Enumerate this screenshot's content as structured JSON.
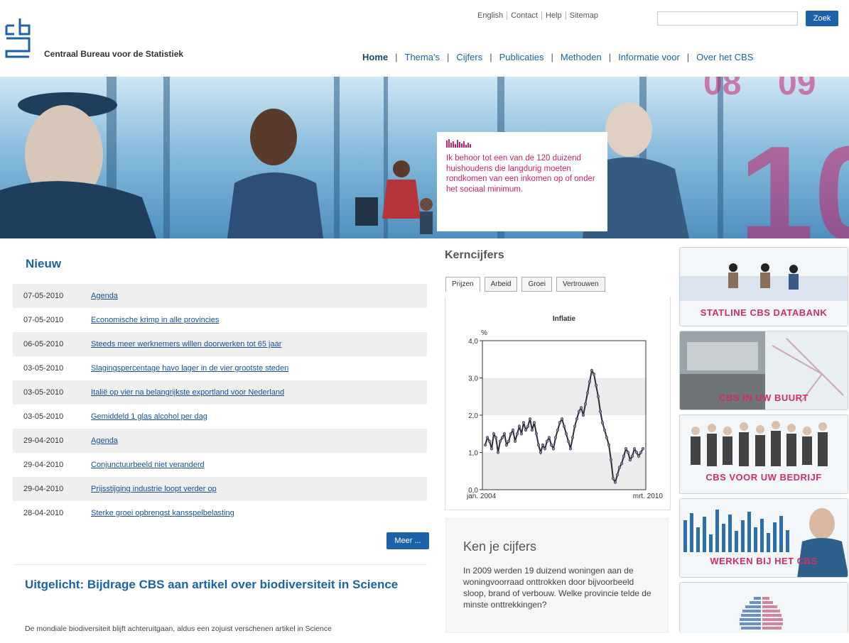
{
  "header": {
    "org_name": "Centraal Bureau voor de Statistiek",
    "util_links": [
      "English",
      "Contact",
      "Help",
      "Sitemap"
    ],
    "search": {
      "value": "",
      "button_label": "Zoek"
    },
    "nav": [
      "Home",
      "Thema's",
      "Cijfers",
      "Publicaties",
      "Methoden",
      "Informatie voor",
      "Over het CBS"
    ],
    "nav_separator": "|",
    "active_nav": "Home"
  },
  "banner": {
    "quote": "Ik behoor tot een van de 120 duizend huishoudens die langdurig moeten rondkomen van een inkomen op of onder het sociaal minimum.",
    "accent_color": "#c7246a"
  },
  "news": {
    "title": "Nieuw",
    "items": [
      {
        "date": "07-05-2010",
        "title": "Agenda"
      },
      {
        "date": "07-05-2010",
        "title": "Economische krimp in alle provincies"
      },
      {
        "date": "06-05-2010",
        "title": "Steeds meer werknemers willen doorwerken tot 65 jaar"
      },
      {
        "date": "03-05-2010",
        "title": "Slagingspercentage havo lager in de vier grootste steden"
      },
      {
        "date": "03-05-2010",
        "title": "Italië op vier na belangrijkste exportland voor Nederland"
      },
      {
        "date": "03-05-2010",
        "title": "Gemiddeld 1 glas alcohol per dag"
      },
      {
        "date": "29-04-2010",
        "title": "Agenda"
      },
      {
        "date": "29-04-2010",
        "title": "Conjunctuurbeeld niet veranderd"
      },
      {
        "date": "29-04-2010",
        "title": "Prijsstijging industrie loopt verder op"
      },
      {
        "date": "28-04-2010",
        "title": "Sterke groei opbrengst kansspelbelasting"
      }
    ],
    "more_label": "Meer ..."
  },
  "featured": {
    "title": "Uitgelicht:   Bijdrage CBS aan artikel over biodiversiteit in Science",
    "text": "De mondiale biodiversiteit blijft achteruitgaan, aldus een zojuist verschenen artikel in Science"
  },
  "keyfigures": {
    "title": "Kerncijfers",
    "tabs": [
      "Prijzen",
      "Arbeid",
      "Groei",
      "Vertrouwen"
    ],
    "active_tab": "Prijzen"
  },
  "chart_data": {
    "type": "line",
    "title": "Inflatie",
    "ylabel": "%",
    "yticks": [
      "0,0",
      "1,0",
      "2,0",
      "3,0",
      "4,0"
    ],
    "ylim": [
      0,
      4
    ],
    "xtick_labels": [
      "jan. 2004",
      "mrt. 2010"
    ],
    "x_start": "jan. 2004",
    "x_end": "mrt. 2010",
    "grid": "horizontal bands",
    "series": [
      {
        "values": [
          1.2,
          1.4,
          1.3,
          1.1,
          1.5,
          1.4,
          1.0,
          1.3,
          1.4,
          1.5,
          1.2,
          1.3,
          1.5,
          1.6,
          1.3,
          1.5,
          1.7,
          1.5,
          1.8,
          1.6,
          1.7,
          1.9,
          1.6,
          1.8,
          1.5,
          1.2,
          1.0,
          1.2,
          1.1,
          1.3,
          1.4,
          1.2,
          1.1,
          1.4,
          1.6,
          1.8,
          1.9,
          1.7,
          1.5,
          1.3,
          1.1,
          1.4,
          1.7,
          1.9,
          2.1,
          2.2,
          2.0,
          2.3,
          2.6,
          2.9,
          3.2,
          3.1,
          2.8,
          2.5,
          2.1,
          1.8,
          1.6,
          1.4,
          1.2,
          0.8,
          0.3,
          0.2,
          0.4,
          0.6,
          0.7,
          0.9,
          1.1,
          1.0,
          0.8,
          0.9,
          1.1,
          1.0,
          0.9,
          1.0,
          1.1
        ]
      }
    ]
  },
  "quiz": {
    "title": "Ken je cijfers",
    "text": "In 2009 werden 19 duizend woningen aan de woningvoorraad onttrokken door bijvoorbeeld sloop, brand of verbouw. Welke provincie telde de minste onttrekkingen?"
  },
  "promos": [
    {
      "label": "STATLINE CBS DATABANK"
    },
    {
      "label": "CBS IN UW BUURT"
    },
    {
      "label": "CBS VOOR UW BEDRIJF"
    },
    {
      "label": "WERKEN BIJ HET CBS"
    }
  ]
}
